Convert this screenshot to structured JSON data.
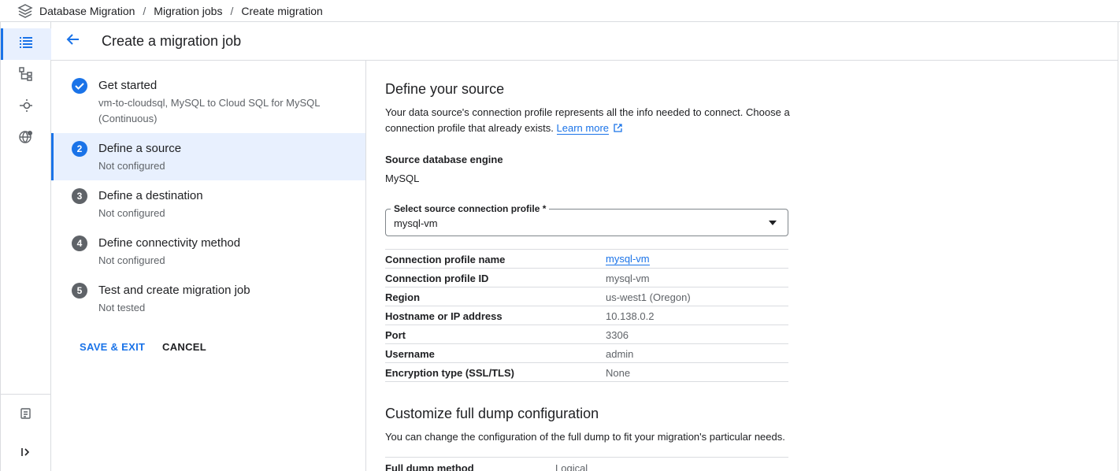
{
  "breadcrumb": {
    "product": "Database Migration",
    "section": "Migration jobs",
    "current": "Create migration",
    "separator": "/"
  },
  "header": {
    "title": "Create a migration job"
  },
  "steps": [
    {
      "number": "",
      "title": "Get started",
      "subtitle": "vm-to-cloudsql, MySQL to Cloud SQL for MySQL (Continuous)",
      "status": "complete"
    },
    {
      "number": "2",
      "title": "Define a source",
      "subtitle": "Not configured",
      "status": "active"
    },
    {
      "number": "3",
      "title": "Define a destination",
      "subtitle": "Not configured",
      "status": "pending"
    },
    {
      "number": "4",
      "title": "Define connectivity method",
      "subtitle": "Not configured",
      "status": "pending"
    },
    {
      "number": "5",
      "title": "Test and create migration job",
      "subtitle": "Not tested",
      "status": "pending"
    }
  ],
  "actions": {
    "save_exit": "SAVE & EXIT",
    "cancel": "CANCEL"
  },
  "source": {
    "heading": "Define your source",
    "description": "Your data source's connection profile represents all the info needed to connect. Choose a connection profile that already exists.",
    "learn_more": "Learn more",
    "engine_label": "Source database engine",
    "engine_value": "MySQL",
    "select_label": "Select source connection profile *",
    "select_value": "mysql-vm",
    "details": [
      {
        "key": "Connection profile name",
        "value": "mysql-vm",
        "link": true
      },
      {
        "key": "Connection profile ID",
        "value": "mysql-vm"
      },
      {
        "key": "Region",
        "value": "us-west1 (Oregon)"
      },
      {
        "key": "Hostname or IP address",
        "value": "10.138.0.2"
      },
      {
        "key": "Port",
        "value": "3306"
      },
      {
        "key": "Username",
        "value": "admin"
      },
      {
        "key": "Encryption type (SSL/TLS)",
        "value": "None"
      }
    ]
  },
  "dump": {
    "heading": "Customize full dump configuration",
    "description": "You can change the configuration of the full dump to fit your migration's particular needs.",
    "method_label": "Full dump method",
    "method_value": "Logical"
  },
  "colors": {
    "accent": "#1a73e8",
    "active_bg": "#e8f0fe",
    "border": "#dadce0",
    "muted_text": "#5f6368"
  },
  "icons": {
    "product": "layers-icon",
    "rail": [
      "list-icon",
      "hierarchy-icon",
      "connection-icon",
      "globe-settings-icon",
      "release-notes-icon",
      "expand-rail-icon"
    ],
    "back": "arrow-back-icon",
    "step_complete": "check-circle-icon",
    "external_link": "open-in-new-icon"
  }
}
